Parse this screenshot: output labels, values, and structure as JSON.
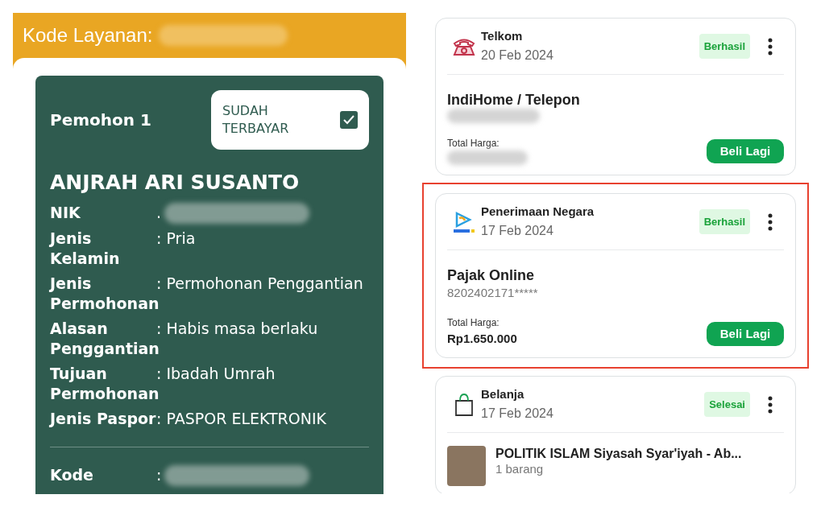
{
  "application": {
    "header_label": "Kode Layanan:",
    "applicant": {
      "title": "Pemohon 1",
      "paid_label": "SUDAH TERBAYAR",
      "paid": true,
      "name": "ANJRAH ARI SUSANTO",
      "fields": [
        {
          "kind": "redacted",
          "label": "NIK",
          "value": "."
        },
        {
          "kind": "text",
          "label": "Jenis Kelamin",
          "value": ": Pria"
        },
        {
          "kind": "text",
          "label": "Jenis Permohonan",
          "value": ": Permohonan Penggantian"
        },
        {
          "kind": "text",
          "label": "Alasan Penggantian",
          "value": ": Habis masa berlaku"
        },
        {
          "kind": "text",
          "label": "Tujuan Permohonan",
          "value": ": Ibadah Umrah"
        },
        {
          "kind": "text",
          "label": "Jenis Paspor",
          "value": ": PASPOR ELEKTRONIK"
        }
      ],
      "footer_fields": [
        {
          "kind": "redacted",
          "label": "Kode",
          "value": ":"
        }
      ]
    }
  },
  "transactions": [
    {
      "kind": "phone",
      "merchant": "Telkom",
      "date": "20 Feb 2024",
      "status": "Berhasil",
      "highlighted": false,
      "body": {
        "kind": "bill",
        "title": "IndiHome / Telepon",
        "total_label": "Total Harga:",
        "button": "Beli Lagi"
      }
    },
    {
      "kind": "mpn",
      "merchant": "Penerimaan Negara",
      "date": "17 Feb 2024",
      "status": "Berhasil",
      "highlighted": true,
      "body": {
        "kind": "bill",
        "title": "Pajak Online",
        "subtitle": "8202402171*****",
        "total_label": "Total Harga:",
        "price": "Rp1.650.000",
        "button": "Beli Lagi"
      }
    },
    {
      "kind": "bag",
      "merchant": "Belanja",
      "date": "17 Feb 2024",
      "status": "Selesai",
      "highlighted": false,
      "body": {
        "kind": "product",
        "title": "POLITIK ISLAM Siyasah Syar'iyah - Ab...",
        "subtitle": "1 barang"
      }
    }
  ]
}
